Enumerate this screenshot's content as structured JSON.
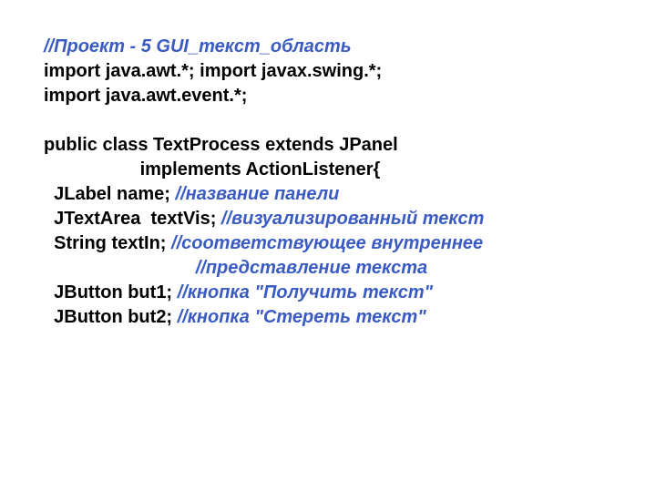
{
  "lines": [
    {
      "type": "comment",
      "indent": "",
      "text": "//Проект - 5 GUI_текст_область"
    },
    {
      "type": "code",
      "indent": "",
      "text": "import java.awt.*; import javax.swing.*;"
    },
    {
      "type": "code",
      "indent": "",
      "text": "import java.awt.event.*;"
    },
    {
      "type": "blank"
    },
    {
      "type": "code",
      "indent": "",
      "text": "public class TextProcess extends JPanel"
    },
    {
      "type": "code",
      "indent": "                   ",
      "text": "implements ActionListener{"
    },
    {
      "type": "mixed",
      "indent": "  ",
      "code": "JLabel name; ",
      "comment": "//название панели"
    },
    {
      "type": "mixed",
      "indent": "  ",
      "code": "JTextArea  textVis; ",
      "comment": "//визуализированный текст"
    },
    {
      "type": "mixed",
      "indent": "  ",
      "code": "String textIn; ",
      "comment": "//соответствующее внутреннее"
    },
    {
      "type": "comment",
      "indent": "                              ",
      "text": "//представление текста"
    },
    {
      "type": "mixed",
      "indent": "  ",
      "code": "JButton but1; ",
      "comment": "//кнопка \"Получить текст\""
    },
    {
      "type": "mixed",
      "indent": "  ",
      "code": "JButton but2; ",
      "comment": "//кнопка \"Стереть текст\""
    }
  ]
}
